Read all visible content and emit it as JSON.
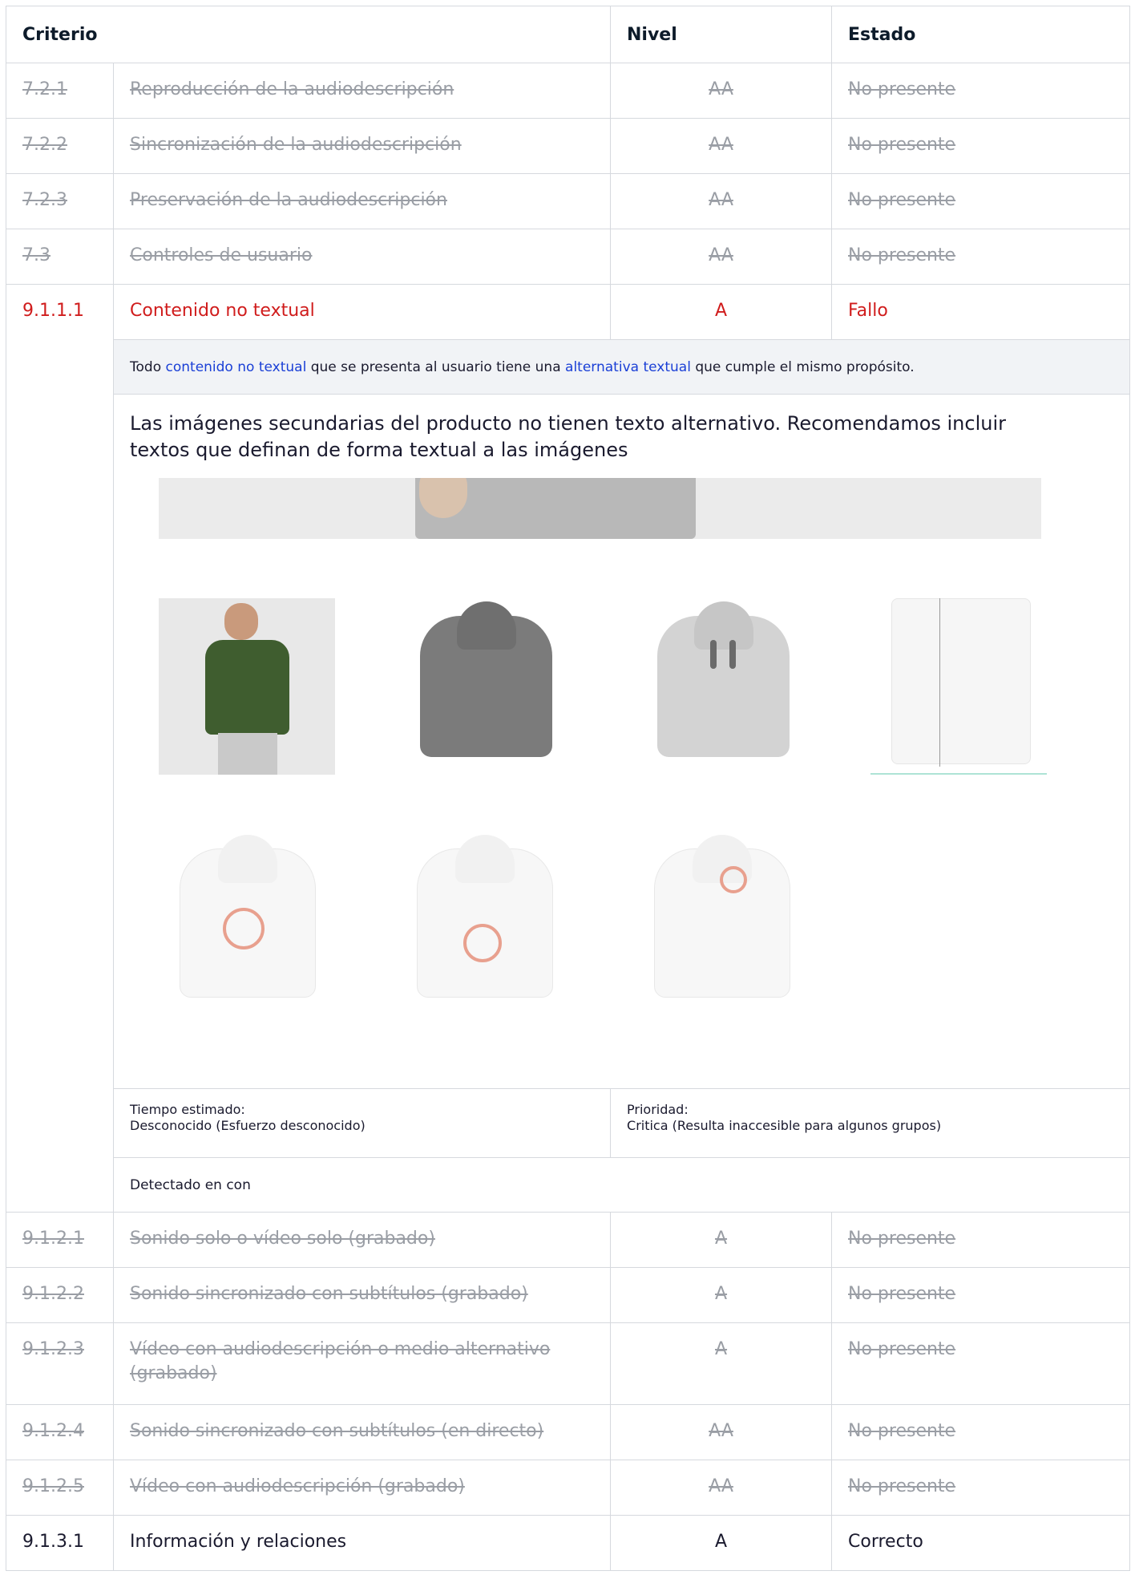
{
  "header": {
    "criterio": "Criterio",
    "nivel": "Nivel",
    "estado": "Estado"
  },
  "rows_before": [
    {
      "id": "7.2.1",
      "name": "Reproducción de la audiodescripción",
      "level": "AA",
      "status": "No presente"
    },
    {
      "id": "7.2.2",
      "name": "Sincronización de la audiodescripción",
      "level": "AA",
      "status": "No presente"
    },
    {
      "id": "7.2.3",
      "name": "Preservación de la audiodescripción",
      "level": "AA",
      "status": "No presente"
    },
    {
      "id": "7.3",
      "name": "Controles de usuario",
      "level": "AA",
      "status": "No presente"
    }
  ],
  "failed": {
    "id": "9.1.1.1",
    "name": "Contenido no textual",
    "level": "A",
    "status": "Fallo",
    "description": {
      "part1": "Todo ",
      "link1": "contenido no textual",
      "part2": " que se presenta al usuario tiene una ",
      "link2": "alternativa textual",
      "part3": " que cumple el mismo propósito."
    },
    "finding": "Las imágenes secundarias del producto no tienen texto alternativo. Recomendamos incluir textos que definan de forma textual a las imágenes",
    "time_label": "Tiempo estimado:",
    "time_value": "Desconocido (Esfuerzo desconocido)",
    "priority_label": "Prioridad:",
    "priority_value": "Critica (Resulta inaccesible para algunos grupos)",
    "detected": "Detectado en con"
  },
  "rows_after": [
    {
      "id": "9.1.2.1",
      "name": "Sonido solo o vídeo solo (grabado)",
      "level": "A",
      "status": "No presente"
    },
    {
      "id": "9.1.2.2",
      "name": "Sonido sincronizado con subtítulos (grabado)",
      "level": "A",
      "status": "No presente"
    },
    {
      "id": "9.1.2.3",
      "name": "Vídeo con audiodescripción o medio alternativo (grabado)",
      "level": "A",
      "status": "No presente"
    },
    {
      "id": "9.1.2.4",
      "name": "Sonido sincronizado con subtítulos (en directo)",
      "level": "AA",
      "status": "No presente"
    },
    {
      "id": "9.1.2.5",
      "name": "Vídeo con audiodescripción (grabado)",
      "level": "AA",
      "status": "No presente"
    }
  ],
  "last_row": {
    "id": "9.1.3.1",
    "name": "Información y relaciones",
    "level": "A",
    "status": "Correcto"
  },
  "colors": {
    "failed": "#d01c1c",
    "struck": "#9a9ea5",
    "link": "#1a3fd6",
    "desc_bg": "#f1f3f6"
  }
}
